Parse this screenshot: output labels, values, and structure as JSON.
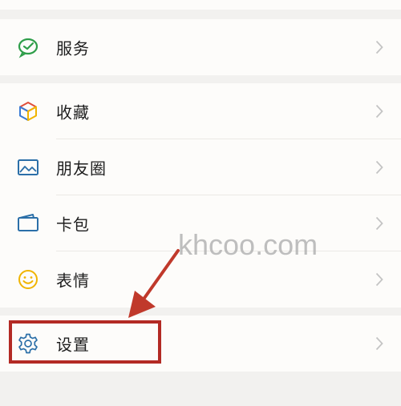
{
  "menu": {
    "items": [
      {
        "label": "服务",
        "icon": "wechat-pay-check-icon"
      },
      {
        "label": "收藏",
        "icon": "favorites-cube-icon"
      },
      {
        "label": "朋友圈",
        "icon": "moments-image-icon"
      },
      {
        "label": "卡包",
        "icon": "card-wallet-icon"
      },
      {
        "label": "表情",
        "icon": "emoji-smile-icon"
      },
      {
        "label": "设置",
        "icon": "settings-gear-icon"
      }
    ]
  },
  "watermark": {
    "text": "khcoo.com"
  },
  "colors": {
    "background": "#f2f1ef",
    "row": "#fdfcfa",
    "highlight_border": "#b32a24",
    "arrow": "#c0392b",
    "chevron": "#c4c4c4"
  }
}
